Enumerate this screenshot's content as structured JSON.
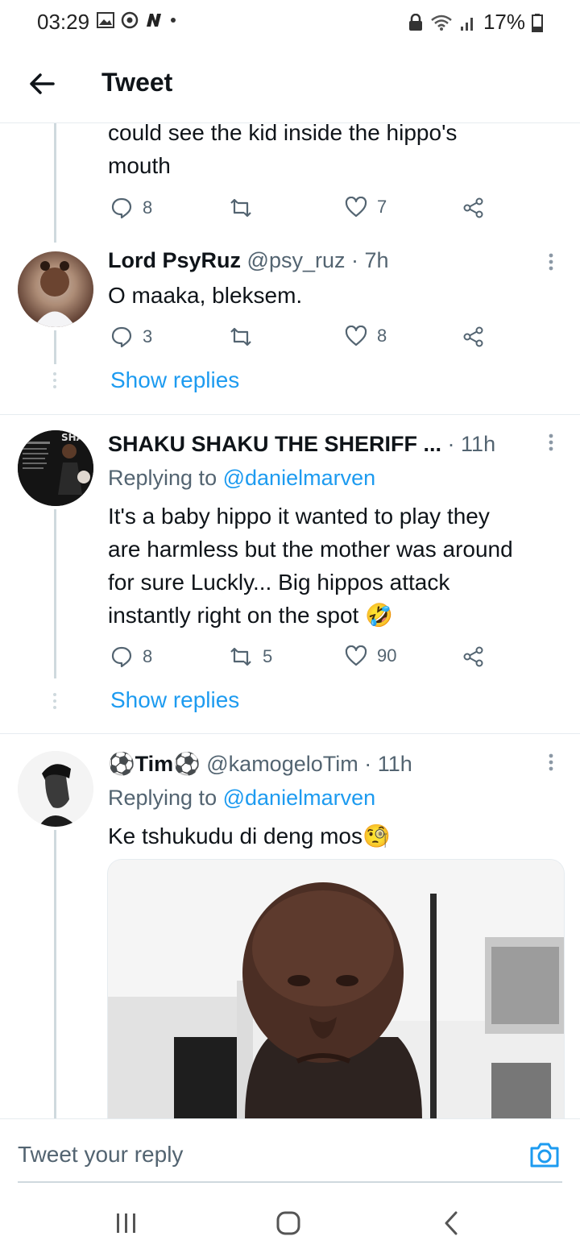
{
  "status_bar": {
    "time": "03:29",
    "battery": "17%"
  },
  "header": {
    "title": "Tweet"
  },
  "tweet_top": {
    "text_line1": "could see the kid inside the hippo's",
    "text_line2": "mouth",
    "replies": "8",
    "retweets": "",
    "likes": "7"
  },
  "tweet_psyruz": {
    "name": "Lord PsyRuz",
    "meta": "@psy_ruz · 7h",
    "text": "O maaka, bleksem.",
    "replies": "3",
    "retweets": "",
    "likes": "8",
    "show_replies": "Show replies"
  },
  "tweet_shaku": {
    "name": "SHAKU SHAKU THE SHERIFF ...",
    "meta": "· 11h",
    "replying_prefix": "Replying to",
    "replying_handle": "@danielmarven",
    "text_line1": "It's a baby hippo it wanted to play they",
    "text_line2": "are harmless but the mother was around",
    "text_line3": "for sure Luckly... Big hippos attack",
    "text_line4": "instantly right on the spot 🤣",
    "replies": "8",
    "retweets": "5",
    "likes": "90",
    "show_replies": "Show replies"
  },
  "tweet_tim": {
    "name": "⚽Tim⚽",
    "meta": "@kamogeloTim · 11h",
    "replying_prefix": "Replying to",
    "replying_handle": "@danielmarven",
    "text": "Ke tshukudu di deng mos🧐"
  },
  "reply_bar": {
    "placeholder": "Tweet your reply"
  },
  "icons": {
    "reply": "reply-icon",
    "retweet": "retweet-icon",
    "like": "heart-icon",
    "share": "share-icon",
    "camera": "camera-icon",
    "back": "back-arrow-icon"
  },
  "colors": {
    "accent": "#1d9bf0",
    "muted": "#536471",
    "text": "#0f1419"
  }
}
